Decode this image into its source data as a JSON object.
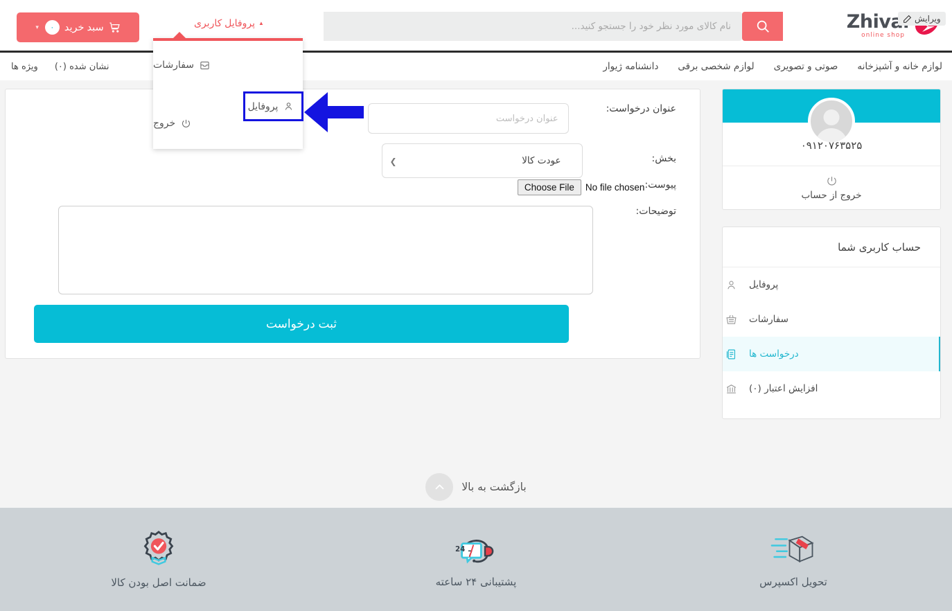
{
  "header": {
    "cart": {
      "label": "سبد خرید",
      "count": "۰",
      "icon": "shopping-cart-icon",
      "chevron": "▾"
    },
    "profile_menu": {
      "label": "پروفایل کاربری",
      "caret": "▲"
    },
    "search": {
      "placeholder": "نام کالای مورد نظر خود را جستجو کنید...",
      "value": "",
      "icon": "search-icon"
    },
    "logo": {
      "text": "Zhivar",
      "subtitle": "online shop"
    },
    "edit_badge": {
      "label": "ویرایش",
      "icon": "pencil-icon"
    },
    "nav_main": [
      {
        "label": "لوازم خانه و آشپزخانه"
      },
      {
        "label": "صوتی و تصویری"
      },
      {
        "label": "لوازم شخصی برقی"
      },
      {
        "label": "دانشنامه ژیوار"
      }
    ],
    "nav_left": [
      {
        "label": "ویژه ها"
      },
      {
        "label": "نشان شده (۰)"
      }
    ]
  },
  "dropdown": {
    "items": [
      {
        "label": "سفارشات",
        "icon": "inbox-icon"
      },
      {
        "label": "پروفایل",
        "icon": "user-icon"
      },
      {
        "label": "خروج",
        "icon": "power-icon"
      }
    ],
    "highlighted_label": "پروفایل",
    "highlight_color": "#1414e0"
  },
  "form": {
    "title_label": "عنوان درخواست:",
    "title_placeholder": "عنوان درخواست",
    "title_value": "",
    "section_label": "بخش:",
    "section_value": "عودت کالا",
    "section_options": [
      "عودت کالا"
    ],
    "attachment_label": "پیوست:",
    "file_button": "Choose File",
    "file_status": "No file chosen",
    "description_label": "توضیحات:",
    "description_value": "",
    "submit_label": "ثبت درخواست",
    "submit_color": "#06bdd6"
  },
  "sidebar": {
    "phone": "۰۹۱۲۰۷۶۳۵۲۵",
    "logout_label": "خروج از حساب",
    "account_title": "حساب کاربری شما",
    "items": [
      {
        "label": "پروفایل",
        "icon": "user-icon",
        "active": false
      },
      {
        "label": "سفارشات",
        "icon": "basket-icon",
        "active": false
      },
      {
        "label": "درخواست ها",
        "icon": "document-list-icon",
        "active": true
      },
      {
        "label": "افزایش اعتبار (۰)",
        "icon": "bank-icon",
        "active": false
      }
    ],
    "accent_color": "#22b7cf"
  },
  "back_to_top": {
    "label": "بازگشت به بالا",
    "icon": "chevron-up-icon"
  },
  "footer": {
    "features": [
      {
        "label": "تحویل اکسپرس",
        "icon": "express-delivery-box-icon"
      },
      {
        "label": "پشتیبانی ۲۴ ساعته",
        "icon": "headset-247-icon"
      },
      {
        "label": "ضمانت اصل بودن کالا",
        "icon": "guarantee-badge-icon"
      }
    ]
  }
}
